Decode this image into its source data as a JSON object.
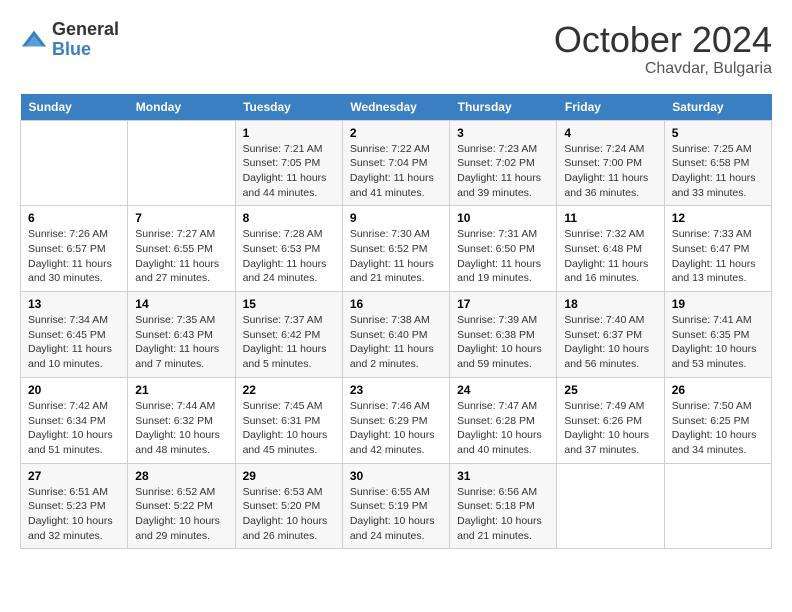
{
  "header": {
    "logo_general": "General",
    "logo_blue": "Blue",
    "month_year": "October 2024",
    "location": "Chavdar, Bulgaria"
  },
  "days_of_week": [
    "Sunday",
    "Monday",
    "Tuesday",
    "Wednesday",
    "Thursday",
    "Friday",
    "Saturday"
  ],
  "weeks": [
    [
      {
        "day": "",
        "info": ""
      },
      {
        "day": "",
        "info": ""
      },
      {
        "day": "1",
        "info": "Sunrise: 7:21 AM\nSunset: 7:05 PM\nDaylight: 11 hours and 44 minutes."
      },
      {
        "day": "2",
        "info": "Sunrise: 7:22 AM\nSunset: 7:04 PM\nDaylight: 11 hours and 41 minutes."
      },
      {
        "day": "3",
        "info": "Sunrise: 7:23 AM\nSunset: 7:02 PM\nDaylight: 11 hours and 39 minutes."
      },
      {
        "day": "4",
        "info": "Sunrise: 7:24 AM\nSunset: 7:00 PM\nDaylight: 11 hours and 36 minutes."
      },
      {
        "day": "5",
        "info": "Sunrise: 7:25 AM\nSunset: 6:58 PM\nDaylight: 11 hours and 33 minutes."
      }
    ],
    [
      {
        "day": "6",
        "info": "Sunrise: 7:26 AM\nSunset: 6:57 PM\nDaylight: 11 hours and 30 minutes."
      },
      {
        "day": "7",
        "info": "Sunrise: 7:27 AM\nSunset: 6:55 PM\nDaylight: 11 hours and 27 minutes."
      },
      {
        "day": "8",
        "info": "Sunrise: 7:28 AM\nSunset: 6:53 PM\nDaylight: 11 hours and 24 minutes."
      },
      {
        "day": "9",
        "info": "Sunrise: 7:30 AM\nSunset: 6:52 PM\nDaylight: 11 hours and 21 minutes."
      },
      {
        "day": "10",
        "info": "Sunrise: 7:31 AM\nSunset: 6:50 PM\nDaylight: 11 hours and 19 minutes."
      },
      {
        "day": "11",
        "info": "Sunrise: 7:32 AM\nSunset: 6:48 PM\nDaylight: 11 hours and 16 minutes."
      },
      {
        "day": "12",
        "info": "Sunrise: 7:33 AM\nSunset: 6:47 PM\nDaylight: 11 hours and 13 minutes."
      }
    ],
    [
      {
        "day": "13",
        "info": "Sunrise: 7:34 AM\nSunset: 6:45 PM\nDaylight: 11 hours and 10 minutes."
      },
      {
        "day": "14",
        "info": "Sunrise: 7:35 AM\nSunset: 6:43 PM\nDaylight: 11 hours and 7 minutes."
      },
      {
        "day": "15",
        "info": "Sunrise: 7:37 AM\nSunset: 6:42 PM\nDaylight: 11 hours and 5 minutes."
      },
      {
        "day": "16",
        "info": "Sunrise: 7:38 AM\nSunset: 6:40 PM\nDaylight: 11 hours and 2 minutes."
      },
      {
        "day": "17",
        "info": "Sunrise: 7:39 AM\nSunset: 6:38 PM\nDaylight: 10 hours and 59 minutes."
      },
      {
        "day": "18",
        "info": "Sunrise: 7:40 AM\nSunset: 6:37 PM\nDaylight: 10 hours and 56 minutes."
      },
      {
        "day": "19",
        "info": "Sunrise: 7:41 AM\nSunset: 6:35 PM\nDaylight: 10 hours and 53 minutes."
      }
    ],
    [
      {
        "day": "20",
        "info": "Sunrise: 7:42 AM\nSunset: 6:34 PM\nDaylight: 10 hours and 51 minutes."
      },
      {
        "day": "21",
        "info": "Sunrise: 7:44 AM\nSunset: 6:32 PM\nDaylight: 10 hours and 48 minutes."
      },
      {
        "day": "22",
        "info": "Sunrise: 7:45 AM\nSunset: 6:31 PM\nDaylight: 10 hours and 45 minutes."
      },
      {
        "day": "23",
        "info": "Sunrise: 7:46 AM\nSunset: 6:29 PM\nDaylight: 10 hours and 42 minutes."
      },
      {
        "day": "24",
        "info": "Sunrise: 7:47 AM\nSunset: 6:28 PM\nDaylight: 10 hours and 40 minutes."
      },
      {
        "day": "25",
        "info": "Sunrise: 7:49 AM\nSunset: 6:26 PM\nDaylight: 10 hours and 37 minutes."
      },
      {
        "day": "26",
        "info": "Sunrise: 7:50 AM\nSunset: 6:25 PM\nDaylight: 10 hours and 34 minutes."
      }
    ],
    [
      {
        "day": "27",
        "info": "Sunrise: 6:51 AM\nSunset: 5:23 PM\nDaylight: 10 hours and 32 minutes."
      },
      {
        "day": "28",
        "info": "Sunrise: 6:52 AM\nSunset: 5:22 PM\nDaylight: 10 hours and 29 minutes."
      },
      {
        "day": "29",
        "info": "Sunrise: 6:53 AM\nSunset: 5:20 PM\nDaylight: 10 hours and 26 minutes."
      },
      {
        "day": "30",
        "info": "Sunrise: 6:55 AM\nSunset: 5:19 PM\nDaylight: 10 hours and 24 minutes."
      },
      {
        "day": "31",
        "info": "Sunrise: 6:56 AM\nSunset: 5:18 PM\nDaylight: 10 hours and 21 minutes."
      },
      {
        "day": "",
        "info": ""
      },
      {
        "day": "",
        "info": ""
      }
    ]
  ]
}
